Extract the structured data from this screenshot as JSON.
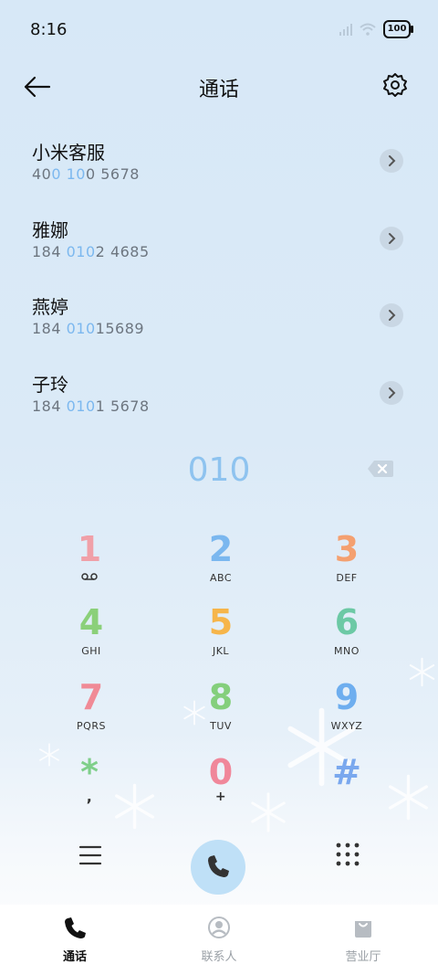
{
  "status_bar": {
    "time": "8:16",
    "battery": "100"
  },
  "header": {
    "title": "通话"
  },
  "contacts": [
    {
      "name": "小米客服",
      "num_parts": [
        "40",
        "0 10",
        "0 5678"
      ]
    },
    {
      "name": "雅娜",
      "num_parts": [
        "184 ",
        "010",
        "2 4685"
      ]
    },
    {
      "name": "燕婷",
      "num_parts": [
        "184 ",
        "010",
        "15689"
      ]
    },
    {
      "name": "子玲",
      "num_parts": [
        "184 ",
        "010",
        "1 5678"
      ]
    }
  ],
  "dialer": {
    "input": "010"
  },
  "keypad": [
    {
      "digit": "1",
      "letters": "",
      "icon": "voicemail-icon",
      "color": "#f0a0a8"
    },
    {
      "digit": "2",
      "letters": "ABC",
      "color": "#7ab7ef"
    },
    {
      "digit": "3",
      "letters": "DEF",
      "color": "#f4a070"
    },
    {
      "digit": "4",
      "letters": "GHI",
      "color": "#8bd07a"
    },
    {
      "digit": "5",
      "letters": "JKL",
      "color": "#f6b54a"
    },
    {
      "digit": "6",
      "letters": "MNO",
      "color": "#6cc9a5"
    },
    {
      "digit": "7",
      "letters": "PQRS",
      "color": "#f08a96"
    },
    {
      "digit": "8",
      "letters": "TUV",
      "color": "#84cf7c"
    },
    {
      "digit": "9",
      "letters": "WXYZ",
      "color": "#6eaeef"
    },
    {
      "digit": "*",
      "letters": ",",
      "color": "#7fcf8a"
    },
    {
      "digit": "0",
      "letters": "+",
      "color": "#f0879a"
    },
    {
      "digit": "#",
      "letters": "",
      "color": "#7aa8ee"
    }
  ],
  "tabs": [
    {
      "label": "通话",
      "icon": "phone-icon",
      "active": true
    },
    {
      "label": "联系人",
      "icon": "contact-icon",
      "active": false
    },
    {
      "label": "营业厅",
      "icon": "shopping-bag-icon",
      "active": false
    }
  ]
}
